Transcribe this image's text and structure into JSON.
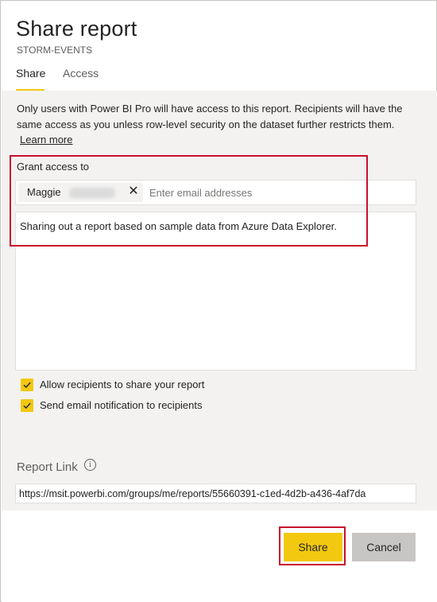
{
  "dialog": {
    "title": "Share report",
    "subtitle": "STORM-EVENTS"
  },
  "tabs": [
    {
      "label": "Share",
      "active": true
    },
    {
      "label": "Access",
      "active": false
    }
  ],
  "info": {
    "text": "Only users with Power BI Pro will have access to this report. Recipients will have the same access as you unless row-level security on the dataset further restricts them.",
    "learn_more": "Learn more"
  },
  "grant": {
    "label": "Grant access to",
    "recipient_name": "Maggie",
    "email_placeholder": "Enter email addresses",
    "message": "Sharing out a report based on sample data from Azure Data Explorer."
  },
  "options": [
    {
      "label": "Allow recipients to share your report",
      "checked": true
    },
    {
      "label": "Send email notification to recipients",
      "checked": true
    }
  ],
  "report_link": {
    "label": "Report Link",
    "url": "https://msit.powerbi.com/groups/me/reports/55660391-c1ed-4d2b-a436-4af7da"
  },
  "buttons": {
    "share": "Share",
    "cancel": "Cancel"
  },
  "colors": {
    "accent": "#f2c811",
    "highlight": "#c8102e",
    "panel": "#f3f2f1"
  },
  "icons": {
    "remove": "close-icon",
    "info": "info-icon",
    "check": "checkmark-icon"
  }
}
